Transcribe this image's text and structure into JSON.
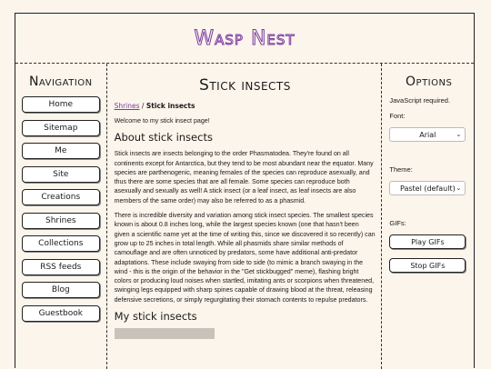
{
  "site": {
    "title": "Wasp Nest"
  },
  "nav": {
    "title": "Navigation",
    "items": [
      "Home",
      "Sitemap",
      "Me",
      "Site",
      "Creations",
      "Shrines",
      "Collections",
      "RSS feeds",
      "Blog",
      "Guestbook"
    ]
  },
  "main": {
    "title": "Stick insects",
    "breadcrumb": {
      "link": "Shrines",
      "sep": " / ",
      "current": "Stick insects"
    },
    "welcome": "Welcome to my stick insect page!",
    "section1": "About stick insects",
    "para1": "Stick insects are insects belonging to the order Phasmatodea. They're found on all continents except for Antarctica, but they tend to be most abundant near the equator. Many species are parthenogenic, meaning females of the species can reproduce asexually, and thus there are some species that are all female. Some species can reproduce both asexually and sexually as well! A stick insect (or a leaf insect, as leaf insects are also members of the same order) may also be referred to as a phasmid.",
    "para2": "There is incredible diversity and variation among stick insect species. The smallest species known is about 0.8 inches long, while the largest species known (one that hasn't been given a scientific name yet at the time of writing this, since we discovered it so recently) can grow up to 25 inches in total length. While all phasmids share similar methods of camouflage and are often unnoticed by predators, some have additional anti-predator adaptations. These include swaying from side to side (to mimic a branch swaying in the wind - this is the origin of the behavior in the \"Get stickbugged\" meme), flashing bright colors or producing loud noises when startled, imitating ants or scorpions when threatened, swinging legs equipped with sharp spines capable of drawing blood at the threat, releasing defensive secretions, or simply regurgitating their stomach contents to repulse predators.",
    "section2": "My stick insects"
  },
  "options": {
    "title": "Options",
    "js_note": "JavaScript required.",
    "font_label": "Font:",
    "font_value": "Arial",
    "theme_label": "Theme:",
    "theme_value": "Pastel (default)",
    "gifs_label": "GIFs:",
    "play_gifs": "Play GIFs",
    "stop_gifs": "Stop GIFs"
  }
}
